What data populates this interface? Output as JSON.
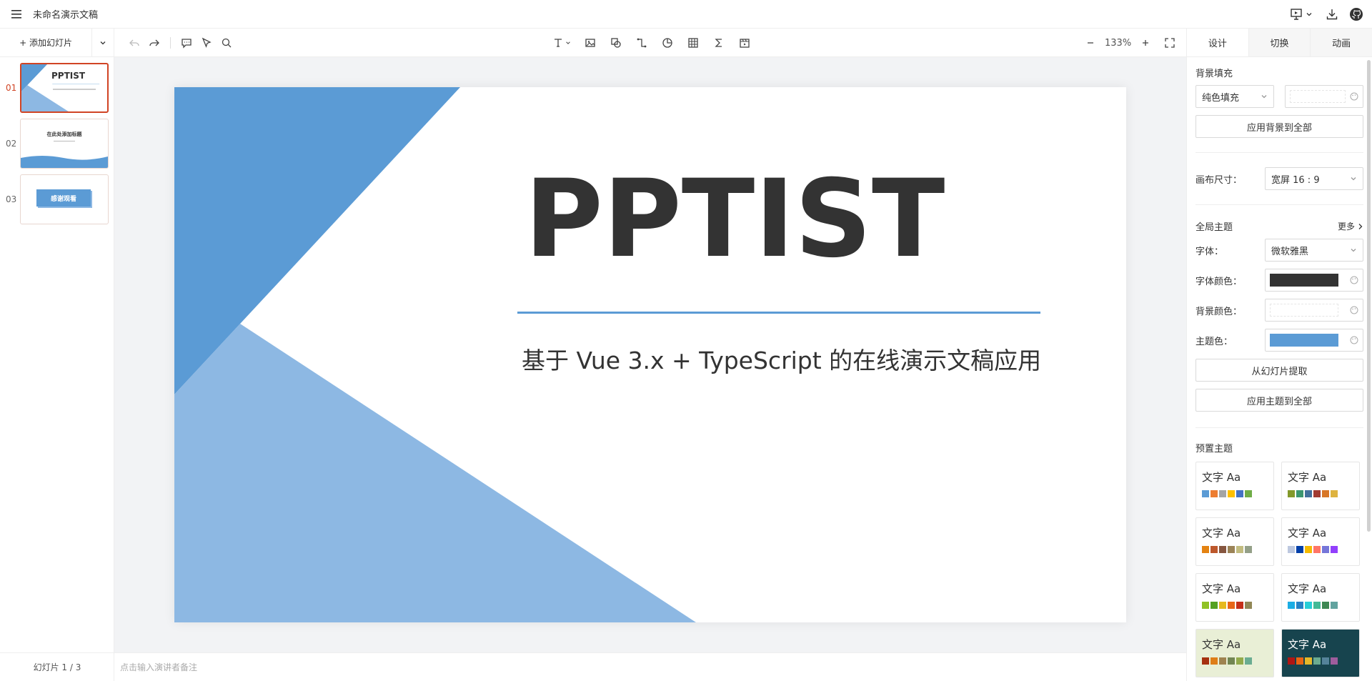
{
  "header": {
    "doc_title": "未命名演示文稿"
  },
  "left": {
    "add_slide_label": "+ 添加幻灯片",
    "thumbnails": [
      {
        "num": "01",
        "title": "PPTIST"
      },
      {
        "num": "02",
        "title": "在此处添加标题"
      },
      {
        "num": "03",
        "title": "感谢观看"
      }
    ],
    "footer": "幻灯片 1 / 3"
  },
  "toolbar": {
    "zoom": "133%"
  },
  "slide": {
    "title": "PPTIST",
    "subtitle": "基于 Vue 3.x + TypeScript 的在线演示文稿应用",
    "colors": {
      "dark_blue": "#5b9bd5",
      "light_blue": "#8db8e3",
      "title": "#333333"
    }
  },
  "remark": {
    "placeholder": "点击输入演讲者备注"
  },
  "right": {
    "tabs": [
      "设计",
      "切换",
      "动画"
    ],
    "background_fill_title": "背景填充",
    "fill_type": "纯色填充",
    "apply_bg_all": "应用背景到全部",
    "canvas_size_label": "画布尺寸：",
    "canvas_size": "宽屏 16 : 9",
    "global_theme_title": "全局主题",
    "more": "更多",
    "font_label": "字体：",
    "font": "微软雅黑",
    "font_color_label": "字体颜色：",
    "font_color": "#333333",
    "bg_color_label": "背景颜色：",
    "bg_color": "#ffffff",
    "theme_color_label": "主题色：",
    "theme_color": "#5b9bd5",
    "extract_from_slide": "从幻灯片提取",
    "apply_theme_all": "应用主题到全部",
    "preset_theme_title": "预置主题",
    "preset_themes": [
      {
        "text": "文字 Aa",
        "bg": "#ffffff",
        "fg": "#333333",
        "colors": [
          "#5b9bd5",
          "#ed7d31",
          "#a5a5a5",
          "#ffc000",
          "#4472c4",
          "#70ad47"
        ]
      },
      {
        "text": "文字 Aa",
        "bg": "#ffffff",
        "fg": "#333333",
        "colors": [
          "#83992a",
          "#3c9670",
          "#44709d",
          "#a23b32",
          "#d87728",
          "#deb340"
        ]
      },
      {
        "text": "文字 Aa",
        "bg": "#ffffff",
        "fg": "#333333",
        "colors": [
          "#e48312",
          "#bd582c",
          "#865640",
          "#9b8357",
          "#c2bc80",
          "#94a088"
        ]
      },
      {
        "text": "文字 Aa",
        "bg": "#ffffff",
        "fg": "#333333",
        "colors": [
          "#bdc8df",
          "#003fa9",
          "#f5ba00",
          "#ff7567",
          "#7676d9",
          "#923ffc"
        ]
      },
      {
        "text": "文字 Aa",
        "bg": "#ffffff",
        "fg": "#333333",
        "colors": [
          "#90c225",
          "#54a121",
          "#e6b91e",
          "#e86618",
          "#c42f19",
          "#918756"
        ]
      },
      {
        "text": "文字 Aa",
        "bg": "#ffffff",
        "fg": "#333333",
        "colors": [
          "#1cade4",
          "#2683c6",
          "#27ced7",
          "#42ba97",
          "#3e8853",
          "#62a39f"
        ]
      },
      {
        "text": "文字 Aa",
        "bg": "#e9efd6",
        "fg": "#333333",
        "colors": [
          "#a5300f",
          "#de7e18",
          "#9f8351",
          "#728653",
          "#92aa4c",
          "#6aac91"
        ]
      },
      {
        "text": "文字 Aa",
        "bg": "#17444e",
        "fg": "#ffffff",
        "colors": [
          "#b01513",
          "#ea6312",
          "#e6b729",
          "#6bab90",
          "#55839a",
          "#9e5d9d"
        ]
      }
    ]
  }
}
